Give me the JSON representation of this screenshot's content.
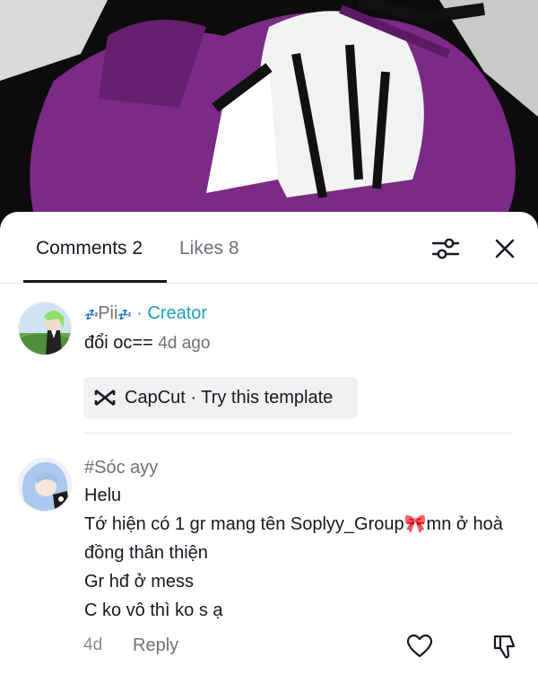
{
  "tabs": {
    "comments_label": "Comments 2",
    "likes_label": "Likes 8"
  },
  "icons": {
    "filter": "sliders-icon",
    "close": "close-icon",
    "capcut": "capcut-logo-icon",
    "like": "heart-outline-icon",
    "dislike": "thumbs-down-icon"
  },
  "colors": {
    "creator_accent": "#1a9ec8",
    "video_purple": "#7b2a85"
  },
  "comments": [
    {
      "username": "Pii",
      "username_decor": "💤",
      "creator_label": "· Creator",
      "text": "đổi oc==",
      "time": "4d ago",
      "capcut_text": "CapCut · Try this template"
    },
    {
      "username": "#Sóc ayy",
      "lines": [
        "Helu",
        "Tớ hiện có 1 gr mang tên Soplyy_Group🎀mn ở hoà đồng thân thiện",
        "Gr hđ ở mess",
        "C ko vô thì ko s ạ"
      ],
      "time": "4d",
      "reply_label": "Reply"
    }
  ]
}
